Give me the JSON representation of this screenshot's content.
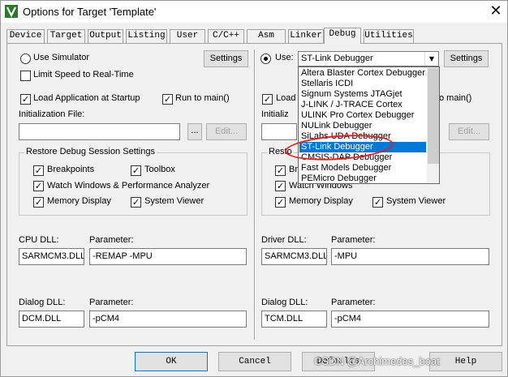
{
  "window": {
    "title": "Options for Target 'Template'",
    "close_label": "✕"
  },
  "tabs": [
    "Device",
    "Target",
    "Output",
    "Listing",
    "User",
    "C/C++",
    "Asm",
    "Linker",
    "Debug",
    "Utilities"
  ],
  "active_tab": "Debug",
  "left": {
    "use_simulator": "Use Simulator",
    "settings": "Settings",
    "limit_speed": "Limit Speed to Real-Time",
    "load_app": "Load Application at Startup",
    "run_to_main": "Run to main()",
    "init_file_label": "Initialization File:",
    "init_file_value": "",
    "browse": "...",
    "edit": "Edit...",
    "restore_group": "Restore Debug Session Settings",
    "breakpoints": "Breakpoints",
    "toolbox": "Toolbox",
    "watch_windows": "Watch Windows & Performance Analyzer",
    "memory_display": "Memory Display",
    "system_viewer": "System Viewer",
    "cpu_dll_label": "CPU DLL:",
    "cpu_dll_value": "SARMCM3.DLL",
    "cpu_param_label": "Parameter:",
    "cpu_param_value": "-REMAP -MPU",
    "dialog_dll_label": "Dialog DLL:",
    "dialog_dll_value": "DCM.DLL",
    "dialog_param_label": "Parameter:",
    "dialog_param_value": "-pCM4"
  },
  "right": {
    "use_label": "Use:",
    "combo_value": "ST-Link Debugger",
    "settings": "Settings",
    "load_partial": "Load",
    "run_to_main_partial": "o main()",
    "init_file_partial": "Initializ",
    "edit": "Edit...",
    "restore_partial": "Resto",
    "breakpoints_partial": "Brea",
    "watch_windows": "Watch Windows",
    "memory_display": "Memory Display",
    "system_viewer": "System Viewer",
    "driver_dll_label": "Driver DLL:",
    "driver_dll_value": "SARMCM3.DLL",
    "driver_param_label": "Parameter:",
    "driver_param_value": "-MPU",
    "dialog_dll_label": "Dialog DLL:",
    "dialog_dll_value": "TCM.DLL",
    "dialog_param_label": "Parameter:",
    "dialog_param_value": "-pCM4"
  },
  "dropdown": {
    "items": [
      "Altera Blaster Cortex Debugger",
      "Stellaris ICDI",
      "Signum Systems JTAGjet",
      "J-LINK / J-TRACE Cortex",
      "ULINK Pro Cortex Debugger",
      "NULink Debugger",
      "SiLabs UDA Debugger",
      "ST-Link Debugger",
      "CMSIS-DAP Debugger",
      "Fast Models Debugger",
      "PEMicro Debugger"
    ],
    "selected_index": 7
  },
  "footer": {
    "ok": "OK",
    "cancel": "Cancel",
    "defaults": "Defaults",
    "help": "Help"
  },
  "watermark": "CSDN @Archimedes_boat",
  "colors": {
    "selection": "#0078d7",
    "annotation_circle": "#e22020",
    "dialog_bg": "#f0f0f0"
  }
}
